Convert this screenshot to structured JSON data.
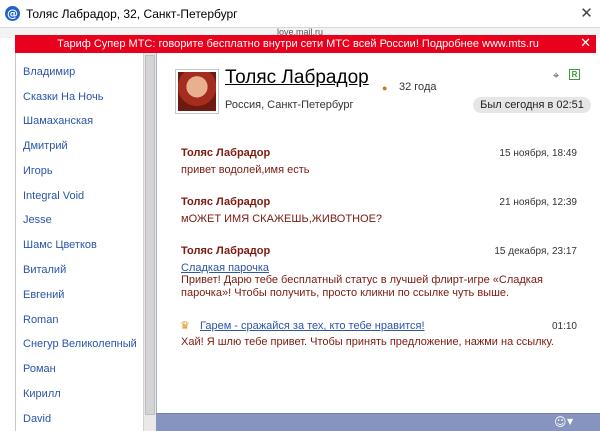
{
  "window": {
    "title": "Толяс Лабрадор, 32, Санкт-Петербург",
    "close_glyph": "✕",
    "app_glyph": "@"
  },
  "address": {
    "url": "love.mail.ru"
  },
  "banner": {
    "text": "Тариф Супер МТС: говорите бесплатно внутри сети МТС всей России! Подробнее www.mts.ru",
    "close_glyph": "✕",
    "color": "#e8001c"
  },
  "sidebar": {
    "items": [
      {
        "label": "Владимир"
      },
      {
        "label": "Сказки На Ночь"
      },
      {
        "label": "Шамаханская"
      },
      {
        "label": "Дмитрий"
      },
      {
        "label": "Игорь"
      },
      {
        "label": "Integral Void"
      },
      {
        "label": "Jesse"
      },
      {
        "label": "Шамс Цветков"
      },
      {
        "label": "Виталий"
      },
      {
        "label": "Евгений"
      },
      {
        "label": "Roman"
      },
      {
        "label": "Снегур Великолепный"
      },
      {
        "label": "Роман"
      },
      {
        "label": "Кирилл"
      },
      {
        "label": "David"
      }
    ]
  },
  "profile": {
    "name": "Толяс Лабрадор",
    "age": "32 года",
    "location": "Россия, Санкт-Петербург",
    "last_seen": "Был сегодня в 02:51",
    "zodiac_icon": "zodiac-icon",
    "binoculars_glyph": "⌖",
    "badge": "R"
  },
  "messages": [
    {
      "author": "Толяс Лабрадор",
      "date": "15 ноября, 18:49",
      "text": "привет водолей,имя есть"
    },
    {
      "author": "Толяс Лабрадор",
      "date": "21 ноября, 12:39",
      "text": "мОЖЕТ ИМЯ СКАЖЕШЬ,ЖИВОТНОЕ?"
    },
    {
      "author": "Толяс Лабрадор",
      "date": "15 декабря, 23:17",
      "link": "Сладкая парочка",
      "text": "Привет! Дарю тебе бесплатный статус в лучшей флирт-игре «Сладкая парочка»! Чтобы получить, просто кликни по ссылке чуть выше."
    }
  ],
  "game_message": {
    "link": "Гарем - сражайся за тех, кто тебе нравится!",
    "time": "01:10",
    "text": "Хай! Я шлю тебе привет. Чтобы принять предложение, нажми на ссылку.",
    "crown_glyph": "♛"
  },
  "bottom_bar": {
    "smiley_glyph": "☺",
    "arrow_glyph": "▼",
    "color": "#8794bf"
  }
}
